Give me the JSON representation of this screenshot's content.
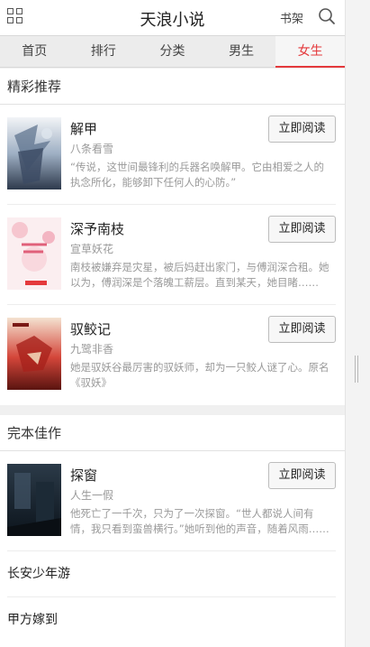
{
  "header": {
    "title": "天浪小说",
    "menu_icon": "grid-menu-icon",
    "shelf_label": "书架",
    "search_icon": "search-icon"
  },
  "tabs": [
    {
      "label": "首页",
      "active": false
    },
    {
      "label": "排行",
      "active": false
    },
    {
      "label": "分类",
      "active": false
    },
    {
      "label": "男生",
      "active": false
    },
    {
      "label": "女生",
      "active": true
    }
  ],
  "accent_color": "#e4393c",
  "featured": {
    "heading": "精彩推荐",
    "books": [
      {
        "title": "解甲",
        "author": "八条看雪",
        "description": "“传说，这世间最锋利的兵器名唤解甲。它由相爱之人的执念所化，能够卸下任何人的心防。”",
        "button": "立即阅读"
      },
      {
        "title": "深予南枝",
        "author": "宣草妖花",
        "description": "南枝被嫌弃是灾星，被后妈赶出家门，与傅润深合租。她以为，傅润深是个落魄工薪层。直到某天，她目睹……",
        "button": "立即阅读"
      },
      {
        "title": "驭鲛记",
        "author": "九鹭非香",
        "description": "她是驭妖谷最厉害的驭妖师，却为一只鲛人谜了心。原名《驭妖》",
        "button": "立即阅读"
      }
    ]
  },
  "completed": {
    "heading": "完本佳作",
    "book": {
      "title": "探窗",
      "author": "人生一假",
      "description": "他死亡了一千次，只为了一次探窗。“世人都说人间有情，我只看到蛮兽横行。”她听到他的声音，随着风雨……",
      "button": "立即阅读"
    },
    "items": [
      "长安少年游",
      "甲方嫁到"
    ]
  }
}
